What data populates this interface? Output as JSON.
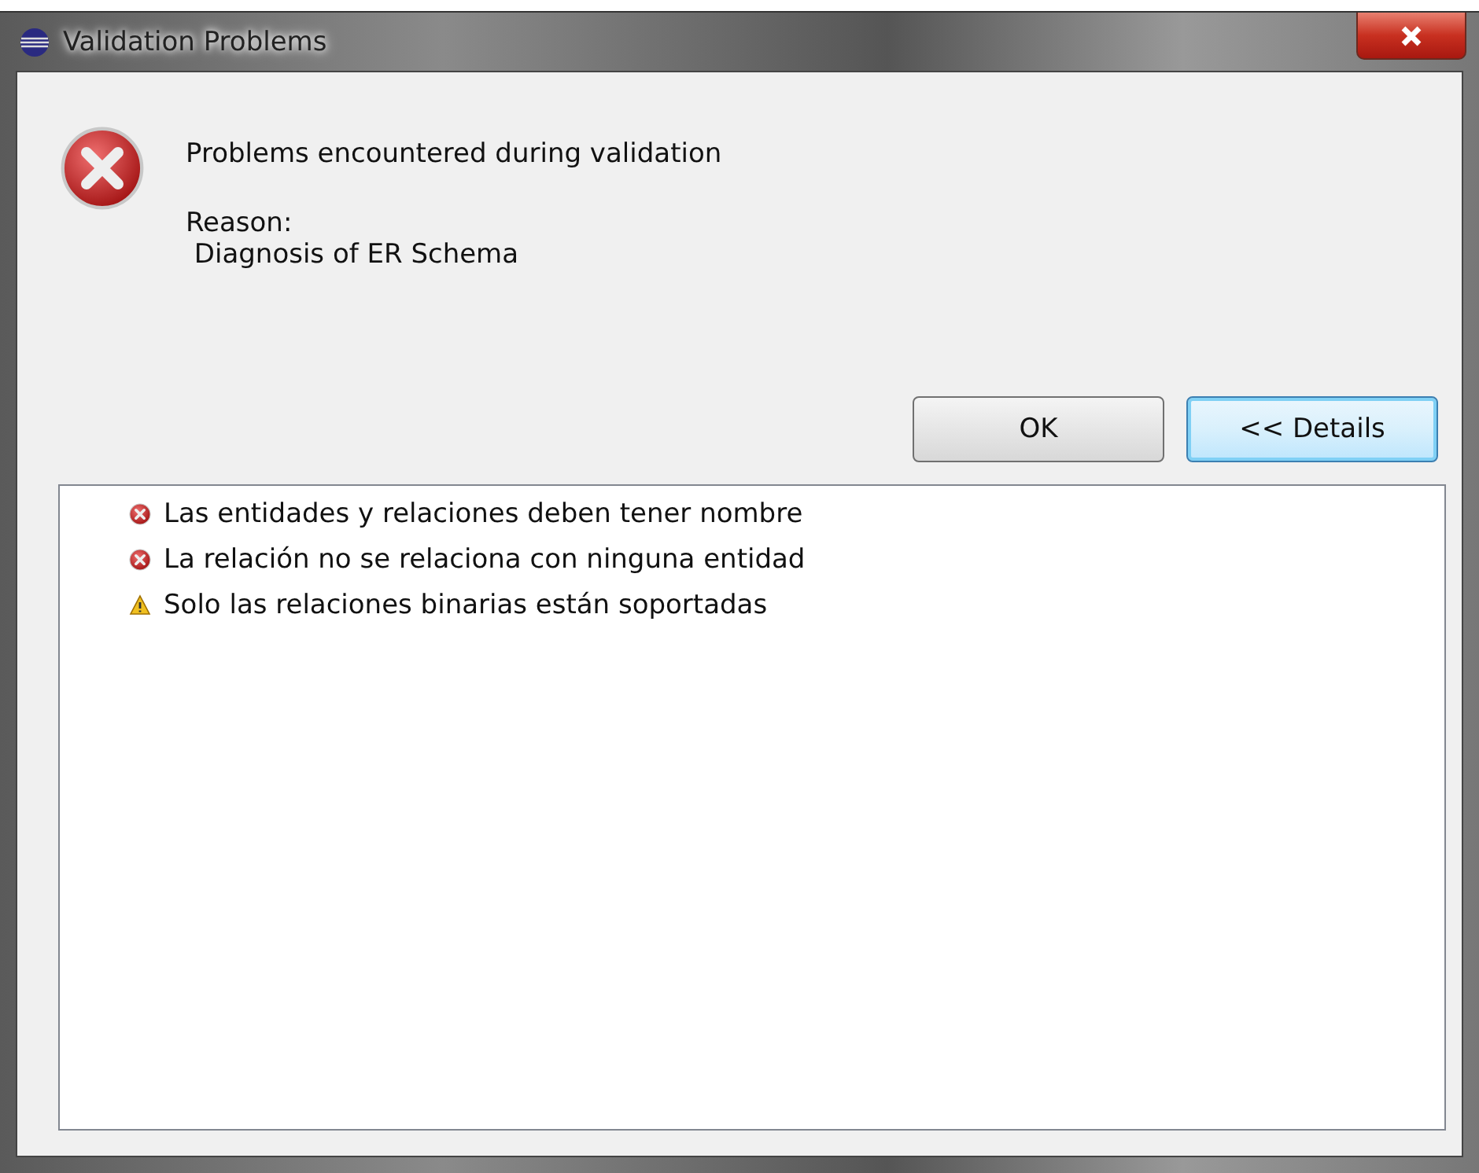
{
  "window": {
    "title": "Validation Problems"
  },
  "message": {
    "title": "Problems encountered during validation",
    "reason_label": "Reason:",
    "reason": " Diagnosis of ER Schema"
  },
  "buttons": [
    {
      "label": "OK",
      "focused": false
    },
    {
      "label": "<< Details",
      "focused": true
    }
  ],
  "details": [
    {
      "kind": "error",
      "text": "Las entidades y relaciones deben tener nombre"
    },
    {
      "kind": "error",
      "text": "La relación no se relaciona con ninguna entidad"
    },
    {
      "kind": "warning",
      "text": "Solo las relaciones binarias están soportadas"
    }
  ]
}
